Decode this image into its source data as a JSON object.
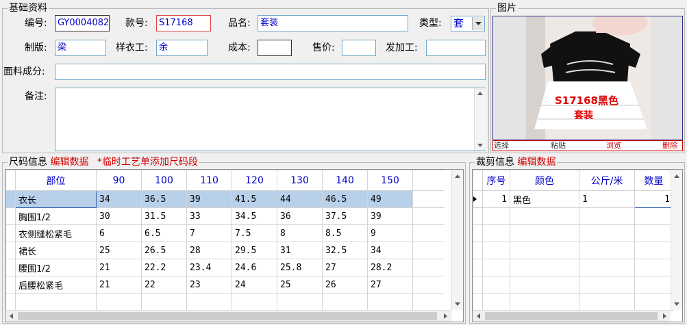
{
  "basic": {
    "legend": "基础资料",
    "labels": {
      "code": "编号:",
      "style_no": "款号:",
      "name": "品名:",
      "type": "类型:",
      "pattern": "制版:",
      "sample_worker": "样衣工:",
      "cost": "成本:",
      "price": "售价:",
      "processor": "发加工:",
      "fabric": "面料成分:",
      "remark": "备注:"
    },
    "values": {
      "code": "GY0004082",
      "style_no": "S17168",
      "name": "套装",
      "type": "套",
      "pattern": "梁",
      "sample_worker": "余",
      "cost": "",
      "price": "",
      "processor": "",
      "fabric": "",
      "remark": ""
    }
  },
  "photo": {
    "legend": "图片",
    "caption_line1": "S17168黑色",
    "caption_line2": "套装",
    "buttons": {
      "select": "选择",
      "paste": "粘贴",
      "browse": "浏览",
      "delete": "删除"
    }
  },
  "size": {
    "legend": "尺码信息",
    "edit_link": "编辑数据",
    "add_link": "*临时工艺单添加尺码段",
    "headers": [
      "部位",
      "90",
      "100",
      "110",
      "120",
      "130",
      "140",
      "150"
    ],
    "rows": [
      [
        "衣长",
        "34",
        "36.5",
        "39",
        "41.5",
        "44",
        "46.5",
        "49"
      ],
      [
        "胸围1/2",
        "30",
        "31.5",
        "33",
        "34.5",
        "36",
        "37.5",
        "39"
      ],
      [
        "衣侧缝松紧毛",
        "6",
        "6.5",
        "7",
        "7.5",
        "8",
        "8.5",
        "9"
      ],
      [
        "裙长",
        "25",
        "26.5",
        "28",
        "29.5",
        "31",
        "32.5",
        "34"
      ],
      [
        "腰围1/2",
        "21",
        "22.2",
        "23.4",
        "24.6",
        "25.8",
        "27",
        "28.2"
      ],
      [
        "后腰松紧毛",
        "21",
        "22",
        "23",
        "24",
        "25",
        "26",
        "27"
      ]
    ]
  },
  "cut": {
    "legend": "裁剪信息",
    "edit_link": "编辑数据",
    "headers": [
      "序号",
      "颜色",
      "公斤/米",
      "数量"
    ],
    "rows": [
      [
        "1",
        "黑色",
        "1",
        "1"
      ]
    ]
  },
  "colors": {
    "accent_red": "#d00000",
    "header_blue": "#0000c8",
    "selected_row": "#b8d0ea"
  }
}
